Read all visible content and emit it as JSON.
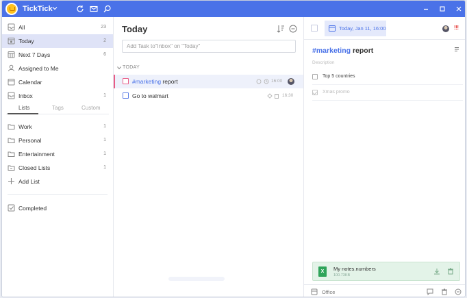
{
  "app": {
    "name": "TickTick"
  },
  "sidebar": {
    "smart_lists": [
      {
        "label": "All",
        "count": "23",
        "icon": "inbox-all-icon"
      },
      {
        "label": "Today",
        "count": "2",
        "icon": "calendar-today-icon",
        "active": true
      },
      {
        "label": "Next 7 Days",
        "count": "6",
        "icon": "calendar-week-icon"
      },
      {
        "label": "Assigned to Me",
        "count": "",
        "icon": "user-icon"
      },
      {
        "label": "Calendar",
        "count": "",
        "icon": "calendar-icon"
      },
      {
        "label": "Inbox",
        "count": "1",
        "icon": "inbox-icon"
      }
    ],
    "tabs": [
      "Lists",
      "Tags",
      "Custom"
    ],
    "lists": [
      {
        "label": "Work",
        "count": "1"
      },
      {
        "label": "Personal",
        "count": "1"
      },
      {
        "label": "Entertainment",
        "count": "1"
      },
      {
        "label": "Closed Lists",
        "count": "1"
      }
    ],
    "add_list_label": "Add List",
    "completed_label": "Completed"
  },
  "main": {
    "title": "Today",
    "add_task_placeholder": "Add Task to\"Inbox\" on \"Today\"",
    "section_title": "TODAY",
    "tasks": [
      {
        "tag": "#marketing",
        "text": " report",
        "time": "16:00",
        "selected": true
      },
      {
        "tag": "",
        "text": "Go to walmart",
        "time": "16:30",
        "selected": false
      }
    ]
  },
  "detail": {
    "date": "Today, Jan 11, 16:00",
    "title_tag": "#marketing",
    "title_text": " report",
    "description_placeholder": "Description",
    "subtasks": [
      {
        "text": "Top 5 countries",
        "done": false
      },
      {
        "text": "Xmas promo",
        "done": true
      }
    ],
    "attachment": {
      "name": "My notes.numbers",
      "size": "100.73KB",
      "icon_letter": "X"
    },
    "list_name": "Office",
    "priority_mark": "!!!"
  },
  "colors": {
    "accent": "#4a72e8",
    "priority": "#e53935",
    "tag_pink": "#e85b86",
    "attachment_green": "#2fa45a"
  }
}
